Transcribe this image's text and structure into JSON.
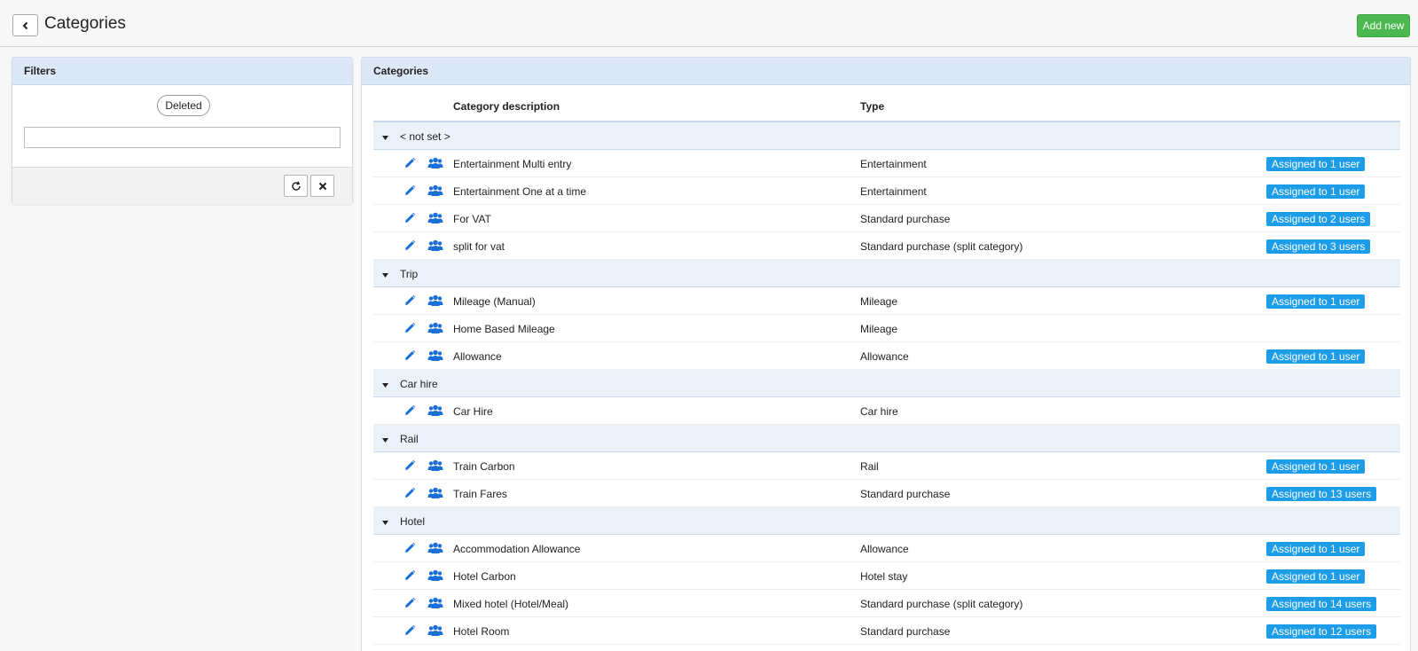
{
  "header": {
    "title": "Categories",
    "add_label": "Add new"
  },
  "filters": {
    "title": "Filters",
    "deleted_label": "Deleted",
    "search_value": ""
  },
  "categories_panel": {
    "title": "Categories",
    "columns": {
      "description": "Category description",
      "type": "Type"
    },
    "groups": [
      {
        "label": "< not set >",
        "items": [
          {
            "description": "Entertainment Multi entry",
            "type": "Entertainment",
            "badge": "Assigned to 1 user"
          },
          {
            "description": "Entertainment One at a time",
            "type": "Entertainment",
            "badge": "Assigned to 1 user"
          },
          {
            "description": "For VAT",
            "type": "Standard purchase",
            "badge": "Assigned to 2 users"
          },
          {
            "description": "split for vat",
            "type": "Standard purchase (split category)",
            "badge": "Assigned to 3 users"
          }
        ]
      },
      {
        "label": "Trip",
        "items": [
          {
            "description": "Mileage (Manual)",
            "type": "Mileage",
            "badge": "Assigned to 1 user"
          },
          {
            "description": "Home Based Mileage",
            "type": "Mileage",
            "badge": ""
          },
          {
            "description": "Allowance",
            "type": "Allowance",
            "badge": "Assigned to 1 user"
          }
        ]
      },
      {
        "label": "Car hire",
        "items": [
          {
            "description": "Car Hire",
            "type": "Car hire",
            "badge": ""
          }
        ]
      },
      {
        "label": "Rail",
        "items": [
          {
            "description": "Train Carbon",
            "type": "Rail",
            "badge": "Assigned to 1 user"
          },
          {
            "description": "Train Fares",
            "type": "Standard purchase",
            "badge": "Assigned to 13 users"
          }
        ]
      },
      {
        "label": "Hotel",
        "items": [
          {
            "description": "Accommodation Allowance",
            "type": "Allowance",
            "badge": "Assigned to 1 user"
          },
          {
            "description": "Hotel Carbon",
            "type": "Hotel stay",
            "badge": "Assigned to 1 user"
          },
          {
            "description": "Mixed hotel (Hotel/Meal)",
            "type": "Standard purchase (split category)",
            "badge": "Assigned to 14 users"
          },
          {
            "description": "Hotel Room",
            "type": "Standard purchase",
            "badge": "Assigned to 12 users"
          }
        ]
      }
    ]
  },
  "colors": {
    "accent": "#1a6fd6",
    "add_button": "#4cb950",
    "badge": "#1d9ce8",
    "panel_header": "#dce8f7",
    "group_row": "#ebf1f8"
  },
  "icons": {
    "back": "chevron-left-icon",
    "edit": "pencil-icon",
    "users": "users-icon",
    "caret": "caret-down-icon",
    "refresh": "refresh-icon",
    "clear": "close-icon"
  }
}
